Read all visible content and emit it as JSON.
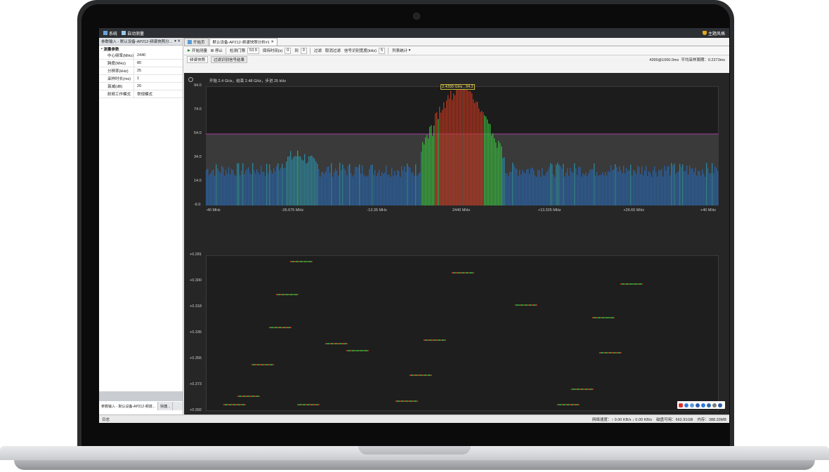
{
  "titlebar": {
    "system": "系统",
    "auto_test": "自动测量",
    "theme": "主题风格"
  },
  "left_panel": {
    "header": "参数输入 - 默认设备-AP212-频谱快照分...",
    "group": "测量参数",
    "params": [
      {
        "key": "中心频率(MHz)",
        "value": "2440"
      },
      {
        "key": "跨度(MHz)",
        "value": "80"
      },
      {
        "key": "分辨率(kHz)",
        "value": "25"
      },
      {
        "key": "采样时长(ms)",
        "value": "1"
      },
      {
        "key": "衰减(dB)",
        "value": "20"
      },
      {
        "key": "射频工作模式",
        "value": "常规模式"
      }
    ],
    "tabs": [
      "参数输入 - 默认设备-AP212-频谱...",
      "快捷..."
    ]
  },
  "doc_tabs": [
    "开始页",
    "默认设备-AP212-频谱快照分析#1"
  ],
  "toolbar": {
    "start": "开始测量",
    "stop": "停止",
    "auto_threshold_label": "检测门限",
    "auto_threshold_value": "53.9",
    "hold_time_label": "保持时间(s)",
    "hold_time_value": "0",
    "to_label": "到",
    "to_value": "0",
    "filter": "过滤",
    "cancel_filter": "取消过滤",
    "signal_bw_label": "信号识别宽度(kHz)",
    "signal_bw_value": "5",
    "list_stats": "列表统计"
  },
  "subtabs": [
    "频谱快照",
    "过滤识别信号结果"
  ],
  "stats": {
    "rate": "4399@1000.0ms",
    "avg_label": "平均采样周期：",
    "avg_value": "0.2273ms"
  },
  "spectrum": {
    "info": "开始 2.4 GHz，结束 2.48 GHz，步进 25 kHz",
    "peak": "2.4390 GHz , 94.2",
    "y_ticks": [
      "94.0",
      "74.0",
      "54.0",
      "34.0",
      "14.0",
      "-6.0"
    ],
    "x_ticks": [
      "-40 MHz",
      "-26.675 MHz",
      "-13.35 MHz",
      "2440 MHz",
      "+13.325 MHz",
      "+26.65 MHz",
      "+40 MHz"
    ],
    "threshold": 54.0
  },
  "waterfall": {
    "y_ticks": [
      "+0.281",
      "+0.300",
      "+0.318",
      "+0.336",
      "+0.355",
      "+0.373",
      "+0.392"
    ]
  },
  "statusbar": {
    "log": "日志",
    "net": "网络速度：↑ 0.00 KB/s ↓ 0.00 KB/s",
    "disk": "磁盘可用：662.91GB",
    "mem": "内存：388.33MB"
  },
  "colors": {
    "accent_green": "#2fbf3a",
    "peak_red": "#c8381f",
    "threshold": "#a040a0",
    "background": "#262626"
  }
}
